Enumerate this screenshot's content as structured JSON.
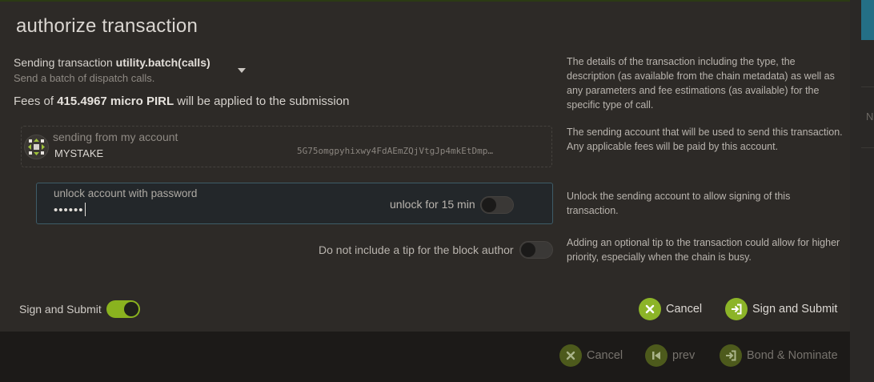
{
  "modal": {
    "title": "authorize transaction",
    "transaction": {
      "prefix": "Sending transaction",
      "call": "utility.batch(calls)",
      "description": "Send a batch of dispatch calls."
    },
    "fees": {
      "prefix": "Fees of",
      "amount": "415.4967 micro PIRL",
      "suffix": "will be applied to the submission"
    },
    "account": {
      "label": "sending from my account",
      "name": "MYSTAKE",
      "address": "5G75omgpyhixwy4FdAEmZQjVtgJp4mkEtDmp…"
    },
    "password": {
      "label": "unlock account with password",
      "value": "••••••",
      "unlock_label": "unlock for 15 min",
      "unlock_on": false
    },
    "tip": {
      "label": "Do not include a tip for the block author",
      "on": false
    },
    "help": {
      "transaction": "The details of the transaction including the type, the description (as available from the chain metadata) as well as any parameters and fee estimations (as available) for the specific type of call.",
      "account": "The sending account that will be used to send this transaction. Any applicable fees will be paid by this account.",
      "unlock": "Unlock the sending account to allow signing of this transaction.",
      "tip": "Adding an optional tip to the transaction could allow for higher priority, especially when the chain is busy."
    },
    "sign_and_submit_toggle": {
      "label": "Sign and Submit",
      "on": true
    },
    "buttons": {
      "cancel": "Cancel",
      "sign_submit": "Sign and Submit"
    }
  },
  "footer": {
    "cancel": "Cancel",
    "prev": "prev",
    "bond_nominate": "Bond & Nominate"
  },
  "colors": {
    "accent": "#8cb428",
    "modal_bg": "#2d2a27",
    "page_bg": "#1f1d1b"
  }
}
